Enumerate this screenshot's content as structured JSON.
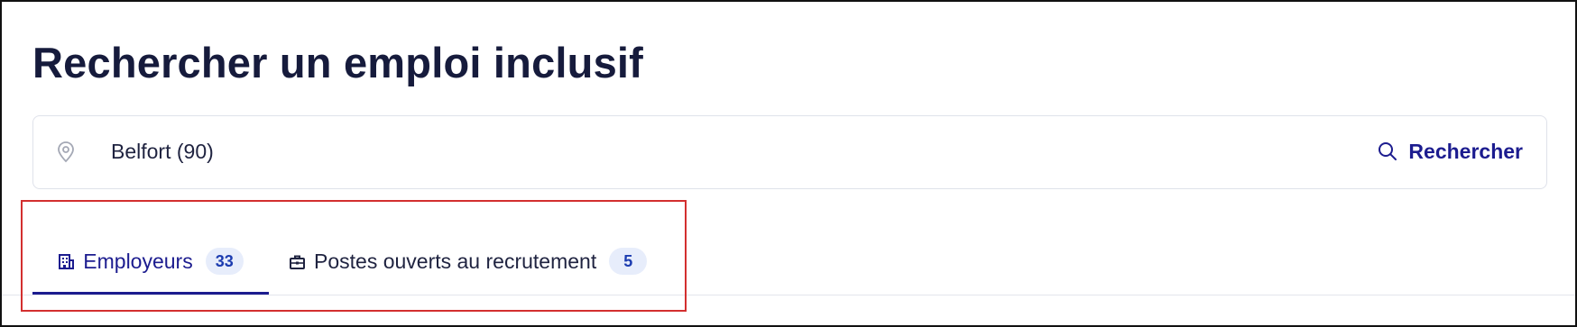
{
  "page": {
    "title": "Rechercher un emploi inclusif"
  },
  "search": {
    "location_value": "Belfort (90)",
    "location_icon": "map-pin-icon",
    "button_label": "Rechercher",
    "button_icon": "search-icon"
  },
  "tabs": [
    {
      "label": "Employeurs",
      "count": "33",
      "icon": "building-icon",
      "active": true
    },
    {
      "label": "Postes ouverts au recrutement",
      "count": "5",
      "icon": "briefcase-icon",
      "active": false
    }
  ],
  "colors": {
    "title": "#161b3c",
    "accent": "#1c1c8f",
    "badge_bg": "#e7edfb",
    "badge_text": "#1c3cb0",
    "highlight": "#d32f2f",
    "border": "#dfe2ea"
  }
}
